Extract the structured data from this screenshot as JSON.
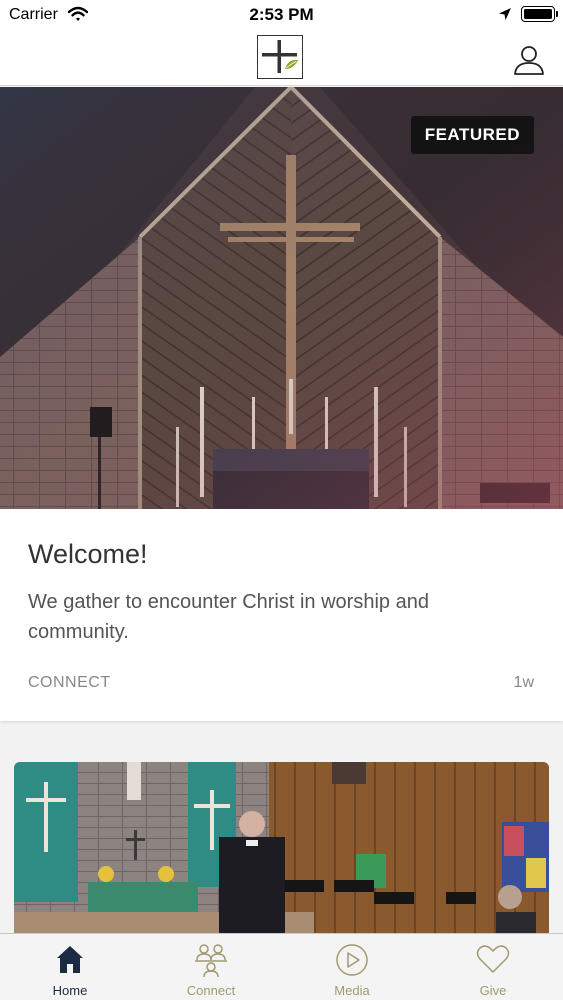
{
  "status_bar": {
    "carrier": "Carrier",
    "time": "2:53 PM"
  },
  "featured": {
    "badge": "FEATURED",
    "title": "Welcome!",
    "description": "We gather to encounter Christ in worship and community.",
    "category": "CONNECT",
    "age": "1w"
  },
  "tabs": [
    {
      "label": "Home",
      "icon": "home-icon",
      "active": true
    },
    {
      "label": "Connect",
      "icon": "connect-icon",
      "active": false
    },
    {
      "label": "Media",
      "icon": "play-icon",
      "active": false
    },
    {
      "label": "Give",
      "icon": "heart-icon",
      "active": false
    }
  ],
  "colors": {
    "tab_active": "#1d2a44",
    "tab_inactive": "#a09a6e"
  }
}
